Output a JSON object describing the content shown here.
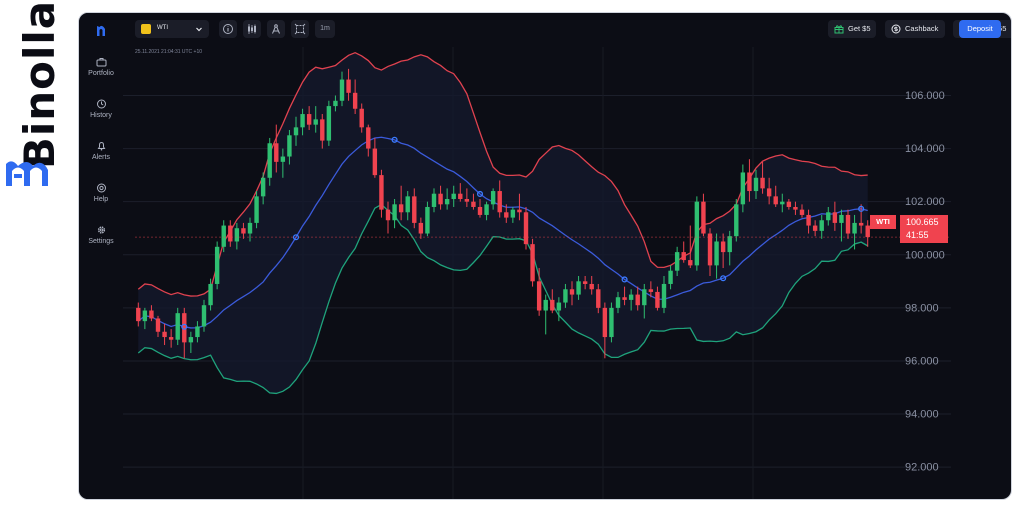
{
  "brand": {
    "name": "Binolla"
  },
  "sidebar": {
    "items": [
      {
        "label": "Portfolio",
        "icon": "briefcase-icon"
      },
      {
        "label": "History",
        "icon": "clock-icon"
      },
      {
        "label": "Alerts",
        "icon": "bell-icon"
      },
      {
        "label": "Help",
        "icon": "help-icon"
      },
      {
        "label": "Settings",
        "icon": "gear-icon"
      }
    ]
  },
  "topbar": {
    "asset": "WTI",
    "timeframe": "1m",
    "bonus_label": "Get $5",
    "cashback_label": "Cashback",
    "balance": "$9,505.55",
    "deposit_label": "Deposit"
  },
  "chart_info": {
    "timestamp": "25.11.2021   21:04:31   UTC +10"
  },
  "price_tag": {
    "symbol": "WTI",
    "price": "100.665",
    "timer": "41:55"
  },
  "colors": {
    "background": "#0c0d15",
    "bull": "#2fbf71",
    "bear": "#f0434f",
    "middle_band": "#3b5bdb",
    "upper_band": "#e0424f",
    "lower_band": "#1fa37c",
    "accent": "#2f6bf0"
  },
  "chart_data": {
    "type": "candlestick",
    "indicator": "Bollinger Bands",
    "y_ticks": [
      92,
      94,
      96,
      98,
      100,
      102,
      104,
      106
    ],
    "ylim": [
      90.8,
      107.6
    ],
    "grid": true,
    "last_price": 100.665,
    "ohlc": [
      [
        98.0,
        98.2,
        97.3,
        97.5
      ],
      [
        97.5,
        98.0,
        97.2,
        97.9
      ],
      [
        97.9,
        98.1,
        97.5,
        97.6
      ],
      [
        97.6,
        97.7,
        96.9,
        97.1
      ],
      [
        97.1,
        97.4,
        96.6,
        96.9
      ],
      [
        96.9,
        97.2,
        96.5,
        96.8
      ],
      [
        96.8,
        98.0,
        96.6,
        97.8
      ],
      [
        97.8,
        98.0,
        96.1,
        96.7
      ],
      [
        96.7,
        97.1,
        96.3,
        96.9
      ],
      [
        96.9,
        97.5,
        96.7,
        97.3
      ],
      [
        97.3,
        98.3,
        97.1,
        98.1
      ],
      [
        98.1,
        99.1,
        97.9,
        98.9
      ],
      [
        98.9,
        100.5,
        98.7,
        100.3
      ],
      [
        100.3,
        101.3,
        100.1,
        101.1
      ],
      [
        101.1,
        101.3,
        100.3,
        100.5
      ],
      [
        100.5,
        101.2,
        100.2,
        101.0
      ],
      [
        101.0,
        101.2,
        100.6,
        100.8
      ],
      [
        100.8,
        101.4,
        100.5,
        101.2
      ],
      [
        101.2,
        102.4,
        101.0,
        102.2
      ],
      [
        102.2,
        103.1,
        101.9,
        102.9
      ],
      [
        102.9,
        104.4,
        102.6,
        104.2
      ],
      [
        104.2,
        104.9,
        103.1,
        103.5
      ],
      [
        103.5,
        104.0,
        102.9,
        103.7
      ],
      [
        103.7,
        104.7,
        103.4,
        104.5
      ],
      [
        104.5,
        105.2,
        104.1,
        104.8
      ],
      [
        104.8,
        105.5,
        104.5,
        105.3
      ],
      [
        105.3,
        105.6,
        104.7,
        104.9
      ],
      [
        104.9,
        105.6,
        104.6,
        105.1
      ],
      [
        105.1,
        105.3,
        104.0,
        104.3
      ],
      [
        104.3,
        105.8,
        104.1,
        105.6
      ],
      [
        105.6,
        106.0,
        105.4,
        105.8
      ],
      [
        105.8,
        106.9,
        105.6,
        106.6
      ],
      [
        106.6,
        107.0,
        105.8,
        106.1
      ],
      [
        106.1,
        106.6,
        105.3,
        105.5
      ],
      [
        105.5,
        105.7,
        104.6,
        104.8
      ],
      [
        104.8,
        104.9,
        103.7,
        104.0
      ],
      [
        104.0,
        104.4,
        102.9,
        103.0
      ],
      [
        103.0,
        103.2,
        101.4,
        101.7
      ],
      [
        101.7,
        102.0,
        100.8,
        101.3
      ],
      [
        101.3,
        102.1,
        101.0,
        101.9
      ],
      [
        101.9,
        102.6,
        101.3,
        101.6
      ],
      [
        101.6,
        102.4,
        101.3,
        102.2
      ],
      [
        102.2,
        102.5,
        101.0,
        101.2
      ],
      [
        101.2,
        101.4,
        100.6,
        100.8
      ],
      [
        100.8,
        102.0,
        100.7,
        101.8
      ],
      [
        101.8,
        102.5,
        101.6,
        102.3
      ],
      [
        102.3,
        102.6,
        101.7,
        101.9
      ],
      [
        101.9,
        102.5,
        101.7,
        102.1
      ],
      [
        102.1,
        102.6,
        101.8,
        102.3
      ],
      [
        102.3,
        102.7,
        102.0,
        102.1
      ],
      [
        102.1,
        102.5,
        101.8,
        102.0
      ],
      [
        102.0,
        102.3,
        101.7,
        101.8
      ],
      [
        101.8,
        102.1,
        101.4,
        101.5
      ],
      [
        101.5,
        102.0,
        101.3,
        101.9
      ],
      [
        101.9,
        102.5,
        101.7,
        102.4
      ],
      [
        102.4,
        102.8,
        101.4,
        101.6
      ],
      [
        101.6,
        101.9,
        101.2,
        101.4
      ],
      [
        101.4,
        101.8,
        101.2,
        101.7
      ],
      [
        101.7,
        102.3,
        101.3,
        101.6
      ],
      [
        101.6,
        101.8,
        100.2,
        100.4
      ],
      [
        100.4,
        100.6,
        98.8,
        99.0
      ],
      [
        99.0,
        99.5,
        97.7,
        97.9
      ],
      [
        97.9,
        98.5,
        97.0,
        98.3
      ],
      [
        98.3,
        98.7,
        97.8,
        97.9
      ],
      [
        97.9,
        98.4,
        97.5,
        98.2
      ],
      [
        98.2,
        98.9,
        98.0,
        98.7
      ],
      [
        98.7,
        99.0,
        98.1,
        98.5
      ],
      [
        98.5,
        99.2,
        98.3,
        99.0
      ],
      [
        99.0,
        99.2,
        98.7,
        98.9
      ],
      [
        98.9,
        99.2,
        98.5,
        98.7
      ],
      [
        98.7,
        98.9,
        97.8,
        98.0
      ],
      [
        98.0,
        98.2,
        96.1,
        96.9
      ],
      [
        96.9,
        98.2,
        96.7,
        98.0
      ],
      [
        98.0,
        98.6,
        97.8,
        98.4
      ],
      [
        98.4,
        98.8,
        98.1,
        98.3
      ],
      [
        98.3,
        98.7,
        97.9,
        98.5
      ],
      [
        98.5,
        98.8,
        97.9,
        98.1
      ],
      [
        98.1,
        98.9,
        97.6,
        98.7
      ],
      [
        98.7,
        99.0,
        98.4,
        98.6
      ],
      [
        98.6,
        98.8,
        97.9,
        98.0
      ],
      [
        98.0,
        99.2,
        97.8,
        98.9
      ],
      [
        98.9,
        99.6,
        98.7,
        99.4
      ],
      [
        99.4,
        100.3,
        99.2,
        100.1
      ],
      [
        100.1,
        100.5,
        99.7,
        99.8
      ],
      [
        99.8,
        101.1,
        99.5,
        99.6
      ],
      [
        99.6,
        102.2,
        99.4,
        102.0
      ],
      [
        102.0,
        102.3,
        100.7,
        100.8
      ],
      [
        100.8,
        101.0,
        99.2,
        99.6
      ],
      [
        99.6,
        100.8,
        99.1,
        100.5
      ],
      [
        100.5,
        100.8,
        99.5,
        100.1
      ],
      [
        100.1,
        100.9,
        99.6,
        100.7
      ],
      [
        100.7,
        102.1,
        100.5,
        101.9
      ],
      [
        101.9,
        103.4,
        101.6,
        103.1
      ],
      [
        103.1,
        103.6,
        102.0,
        102.4
      ],
      [
        102.4,
        103.2,
        102.1,
        102.9
      ],
      [
        102.9,
        103.5,
        102.3,
        102.5
      ],
      [
        102.5,
        102.9,
        101.9,
        102.2
      ],
      [
        102.2,
        102.6,
        101.8,
        101.9
      ],
      [
        101.9,
        102.3,
        101.6,
        102.0
      ],
      [
        102.0,
        102.1,
        101.7,
        101.8
      ],
      [
        101.8,
        102.0,
        101.5,
        101.7
      ],
      [
        101.7,
        101.9,
        101.4,
        101.5
      ],
      [
        101.5,
        101.7,
        100.8,
        101.1
      ],
      [
        101.1,
        101.3,
        100.7,
        100.9
      ],
      [
        100.9,
        101.5,
        100.6,
        101.3
      ],
      [
        101.3,
        101.8,
        101.1,
        101.6
      ],
      [
        101.6,
        102.0,
        100.9,
        101.2
      ],
      [
        101.2,
        101.7,
        100.5,
        101.5
      ],
      [
        101.5,
        101.7,
        100.6,
        100.8
      ],
      [
        100.8,
        101.5,
        100.2,
        101.2
      ],
      [
        101.2,
        101.9,
        100.8,
        101.1
      ],
      [
        101.1,
        101.3,
        100.3,
        100.665
      ]
    ],
    "ma_markers": [
      7,
      24,
      39,
      52,
      74,
      89,
      110
    ]
  }
}
